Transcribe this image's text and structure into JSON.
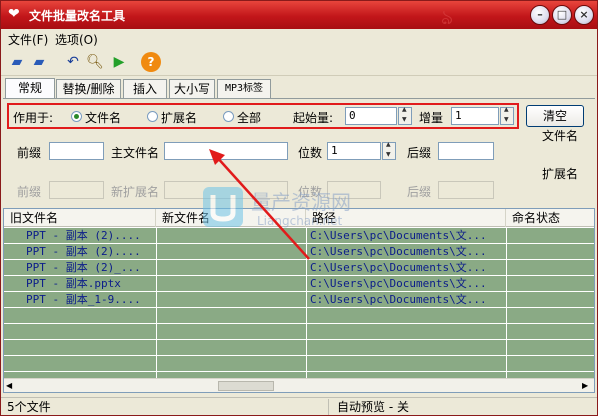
{
  "window": {
    "title": "文件批量改名工具"
  },
  "menu": [
    "文件(F)",
    "选项(O)"
  ],
  "tabs": [
    "常规",
    "替换/删除",
    "插入",
    "大小写",
    "MP3标签"
  ],
  "general": {
    "apply_to_label": "作用于:",
    "radio_filename": "文件名",
    "radio_ext": "扩展名",
    "radio_all": "全部",
    "start_label": "起始量:",
    "start_value": "0",
    "step_label": "增量",
    "step_value": "1",
    "clear_button": "清空",
    "group_filename": "文件名",
    "prefix_label": "前缀",
    "main_name_label": "主文件名",
    "digits_label": "位数",
    "digits_value": "1",
    "suffix_label": "后缀",
    "group_ext": "扩展名",
    "ext_prefix_label": "前缀",
    "new_ext_label": "新扩展名",
    "ext_digits_label": "位数",
    "ext_suffix_label": "后缀"
  },
  "columns": [
    "旧文件名",
    "新文件名",
    "路径",
    "命名状态"
  ],
  "rows": [
    {
      "old": "PPT - 副本 (2)....",
      "new": "",
      "path": "C:\\Users\\pc\\Documents\\文...",
      "status": ""
    },
    {
      "old": "PPT - 副本 (2)....",
      "new": "",
      "path": "C:\\Users\\pc\\Documents\\文...",
      "status": ""
    },
    {
      "old": "PPT - 副本 (2)_...",
      "new": "",
      "path": "C:\\Users\\pc\\Documents\\文...",
      "status": ""
    },
    {
      "old": "PPT - 副本.pptx",
      "new": "",
      "path": "C:\\Users\\pc\\Documents\\文...",
      "status": ""
    },
    {
      "old": "PPT - 副本_1-9....",
      "new": "",
      "path": "C:\\Users\\pc\\Documents\\文...",
      "status": ""
    }
  ],
  "status": {
    "count": "5个文件",
    "preview": "自动预览 - 关"
  },
  "watermark": {
    "text": "量产资源网",
    "url": "Liangchan.net"
  },
  "colors": {
    "title_red": "#c2161a",
    "row_green": "#8aaa85",
    "highlight_red": "#e11b1b",
    "text_blue": "#0b1c8a"
  }
}
